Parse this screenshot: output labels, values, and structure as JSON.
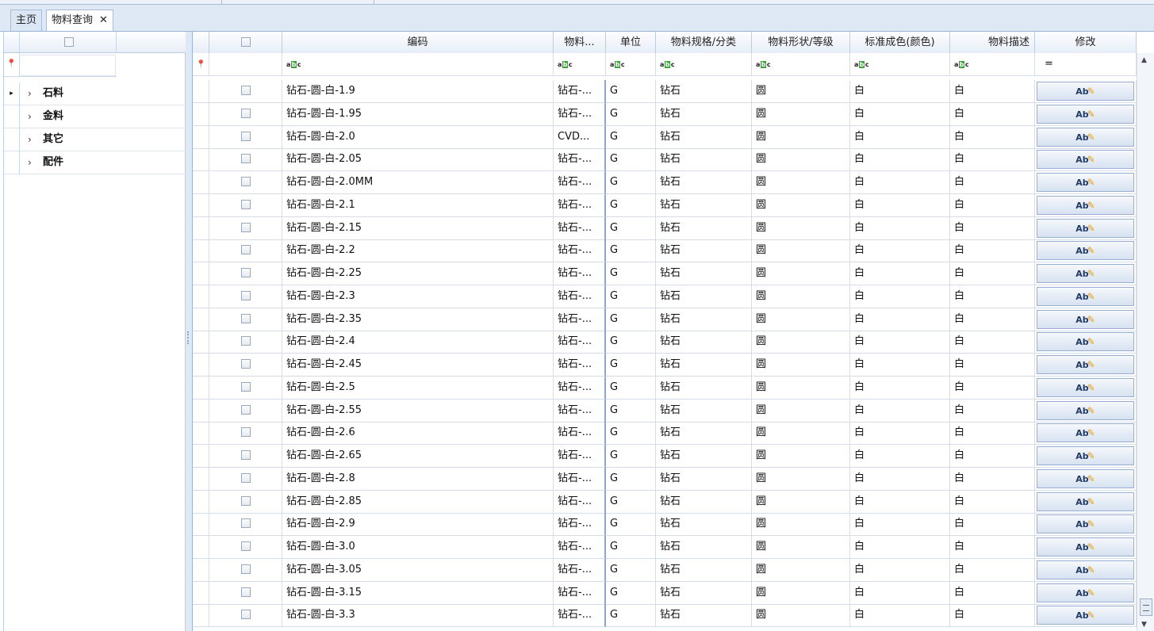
{
  "window": {
    "tabs": [
      {
        "label": "主页",
        "active": false
      },
      {
        "label": "物料查询",
        "active": true,
        "closable": true
      }
    ],
    "close_glyph": "✕"
  },
  "tree": {
    "nodes": [
      {
        "label": "石料",
        "current": true
      },
      {
        "label": "金料",
        "current": false
      },
      {
        "label": "其它",
        "current": false
      },
      {
        "label": "配件",
        "current": false
      }
    ],
    "row_indicator_glyph": "▸",
    "expand_glyph": "›",
    "filter_glyph": "🜂"
  },
  "grid": {
    "columns": [
      "",
      "编码",
      "物料...",
      "单位",
      "物料规格/分类",
      "物料形状/等级",
      "标准成色(颜色)",
      "物料描述",
      "修改"
    ],
    "filter_equals": "=",
    "edit_label": "Ab",
    "rows": [
      {
        "code": "钻石-圆-白-1.9",
        "name": "钻石-...",
        "unit": "G",
        "spec": "钻石",
        "shape": "圆",
        "color": "白",
        "desc": "白"
      },
      {
        "code": "钻石-圆-白-1.95",
        "name": "钻石-...",
        "unit": "G",
        "spec": "钻石",
        "shape": "圆",
        "color": "白",
        "desc": "白"
      },
      {
        "code": "钻石-圆-白-2.0",
        "name": "CVD...",
        "unit": "G",
        "spec": "钻石",
        "shape": "圆",
        "color": "白",
        "desc": "白"
      },
      {
        "code": "钻石-圆-白-2.05",
        "name": "钻石-...",
        "unit": "G",
        "spec": "钻石",
        "shape": "圆",
        "color": "白",
        "desc": "白"
      },
      {
        "code": "钻石-圆-白-2.0MM",
        "name": "钻石-...",
        "unit": "G",
        "spec": "钻石",
        "shape": "圆",
        "color": "白",
        "desc": "白"
      },
      {
        "code": "钻石-圆-白-2.1",
        "name": "钻石-...",
        "unit": "G",
        "spec": "钻石",
        "shape": "圆",
        "color": "白",
        "desc": "白"
      },
      {
        "code": "钻石-圆-白-2.15",
        "name": "钻石-...",
        "unit": "G",
        "spec": "钻石",
        "shape": "圆",
        "color": "白",
        "desc": "白"
      },
      {
        "code": "钻石-圆-白-2.2",
        "name": "钻石-...",
        "unit": "G",
        "spec": "钻石",
        "shape": "圆",
        "color": "白",
        "desc": "白"
      },
      {
        "code": "钻石-圆-白-2.25",
        "name": "钻石-...",
        "unit": "G",
        "spec": "钻石",
        "shape": "圆",
        "color": "白",
        "desc": "白"
      },
      {
        "code": "钻石-圆-白-2.3",
        "name": "钻石-...",
        "unit": "G",
        "spec": "钻石",
        "shape": "圆",
        "color": "白",
        "desc": "白"
      },
      {
        "code": "钻石-圆-白-2.35",
        "name": "钻石-...",
        "unit": "G",
        "spec": "钻石",
        "shape": "圆",
        "color": "白",
        "desc": "白"
      },
      {
        "code": "钻石-圆-白-2.4",
        "name": "钻石-...",
        "unit": "G",
        "spec": "钻石",
        "shape": "圆",
        "color": "白",
        "desc": "白"
      },
      {
        "code": "钻石-圆-白-2.45",
        "name": "钻石-...",
        "unit": "G",
        "spec": "钻石",
        "shape": "圆",
        "color": "白",
        "desc": "白"
      },
      {
        "code": "钻石-圆-白-2.5",
        "name": "钻石-...",
        "unit": "G",
        "spec": "钻石",
        "shape": "圆",
        "color": "白",
        "desc": "白"
      },
      {
        "code": "钻石-圆-白-2.55",
        "name": "钻石-...",
        "unit": "G",
        "spec": "钻石",
        "shape": "圆",
        "color": "白",
        "desc": "白"
      },
      {
        "code": "钻石-圆-白-2.6",
        "name": "钻石-...",
        "unit": "G",
        "spec": "钻石",
        "shape": "圆",
        "color": "白",
        "desc": "白"
      },
      {
        "code": "钻石-圆-白-2.65",
        "name": "钻石-...",
        "unit": "G",
        "spec": "钻石",
        "shape": "圆",
        "color": "白",
        "desc": "白"
      },
      {
        "code": "钻石-圆-白-2.8",
        "name": "钻石-...",
        "unit": "G",
        "spec": "钻石",
        "shape": "圆",
        "color": "白",
        "desc": "白"
      },
      {
        "code": "钻石-圆-白-2.85",
        "name": "钻石-...",
        "unit": "G",
        "spec": "钻石",
        "shape": "圆",
        "color": "白",
        "desc": "白"
      },
      {
        "code": "钻石-圆-白-2.9",
        "name": "钻石-...",
        "unit": "G",
        "spec": "钻石",
        "shape": "圆",
        "color": "白",
        "desc": "白"
      },
      {
        "code": "钻石-圆-白-3.0",
        "name": "钻石-...",
        "unit": "G",
        "spec": "钻石",
        "shape": "圆",
        "color": "白",
        "desc": "白"
      },
      {
        "code": "钻石-圆-白-3.05",
        "name": "钻石-...",
        "unit": "G",
        "spec": "钻石",
        "shape": "圆",
        "color": "白",
        "desc": "白"
      },
      {
        "code": "钻石-圆-白-3.15",
        "name": "钻石-...",
        "unit": "G",
        "spec": "钻石",
        "shape": "圆",
        "color": "白",
        "desc": "白"
      },
      {
        "code": "钻石-圆-白-3.3",
        "name": "钻石-...",
        "unit": "G",
        "spec": "钻石",
        "shape": "圆",
        "color": "白",
        "desc": "白"
      }
    ]
  },
  "colors": {
    "accent": "#99b4d8",
    "filter_icon_green": "#3aa63a",
    "edit_pen": "#e0a020"
  }
}
